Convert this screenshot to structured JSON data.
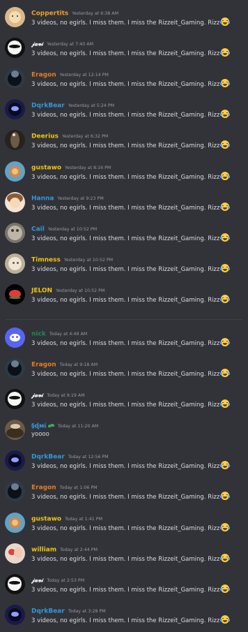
{
  "colors": {
    "background": "#313338",
    "text": "#dbdee1",
    "timestamp": "#949ba4",
    "divider": "#3f4147",
    "name_orange": "#f0a02a",
    "name_red": "#e67e22",
    "name_blue": "#3498db",
    "name_yellow": "#f1c40f",
    "name_green": "#2ecc71",
    "name_dark_green": "#1f8b4c",
    "name_white": "#ffffff"
  },
  "icons": {
    "reaction": "laughing-tears-emoji-icon",
    "badge": "sprout-icon",
    "discord_avatar": "discord-logo-icon"
  },
  "messages": [
    {
      "username": "Coppertits",
      "timestamp": "Yesterday at 6:38 AM",
      "text": "3 videos, no egirls. I miss them. I miss the Rizzeit_Gaming. Rizz",
      "emoji": true,
      "color": "#f0a02a"
    },
    {
      "username": "𝒿𝒶𝓋𝒾",
      "timestamp": "Yesterday at 7:40 AM",
      "text": "3 videos, no egirls. I miss them. I miss the Rizzeit_Gaming. Rizz",
      "emoji": true,
      "color": "#ffffff"
    },
    {
      "username": "Eragon",
      "timestamp": "Yesterday at 12:14 PM",
      "text": "3 videos, no egirls. I miss them. I miss the Rizzeit_Gaming. Rizz",
      "emoji": true,
      "color": "#e67e22"
    },
    {
      "username": "DqrkBear",
      "timestamp": "Yesterday at 5:24 PM",
      "text": "3 videos, no egirls. I miss them. I miss the Rizzeit_Gaming. Rizz",
      "emoji": true,
      "color": "#3498db"
    },
    {
      "username": "Deerius",
      "timestamp": "Yesterday at 6:32 PM",
      "text": "3 videos, no egirls. I miss them. I miss the Rizzeit_Gaming. Rizz",
      "emoji": true,
      "color": "#f1c40f"
    },
    {
      "username": "gustawo",
      "timestamp": "Yesterday at 8:16 PM",
      "text": "3 videos, no egirls. I miss them. I miss the Rizzeit_Gaming. Rizz",
      "emoji": true,
      "color": "#f1c40f"
    },
    {
      "username": "Hanna",
      "timestamp": "Yesterday at 9:23 PM",
      "text": "3 videos, no egirls. I miss them. I miss the Rizzeit_Gaming. Rizz",
      "emoji": true,
      "color": "#3498db"
    },
    {
      "username": "Cail",
      "timestamp": "Yesterday at 10:52 PM",
      "text": "3 videos, no egirls. I miss them. I miss the Rizzeit_Gaming. Rizz",
      "emoji": true,
      "color": "#3498db"
    },
    {
      "username": "Timness",
      "timestamp": "Yesterday at 10:52 PM",
      "text": "3 videos, no egirls. I miss them. I miss the Rizzeit_Gaming. Rizz",
      "emoji": true,
      "color": "#f1c40f"
    },
    {
      "username": "JELON",
      "timestamp": "Yesterday at 10:52 PM",
      "text": "3 videos, no egirls. I miss them. I miss the Rizzeit_Gaming. Rizz",
      "emoji": true,
      "color": "#f1c40f"
    },
    {
      "username": "nick",
      "timestamp": "Today at 4:49 AM",
      "text": "3 videos, no egirls. I miss them. I miss the Rizzeit_Gaming. Rizz",
      "emoji": true,
      "color": "#1f8b4c"
    },
    {
      "username": "Eragon",
      "timestamp": "Today at 9:18 AM",
      "text": "3 videos, no egirls. I miss them. I miss the Rizzeit_Gaming. Rizz",
      "emoji": true,
      "color": "#e67e22"
    },
    {
      "username": "𝒿𝒶𝓋𝒾",
      "timestamp": "Today at 9:19 AM",
      "text": "3 videos, no egirls. I miss them. I miss the Rizzeit_Gaming. Rizz",
      "emoji": true,
      "color": "#ffffff"
    },
    {
      "username": "§ɖмί",
      "timestamp": "Today at 11:20 AM",
      "text": "yoooo",
      "emoji": false,
      "color": "#3498db"
    },
    {
      "username": "DqrkBear",
      "timestamp": "Today at 12:56 PM",
      "text": "3 videos, no egirls. I miss them. I miss the Rizzeit_Gaming. Rizz",
      "emoji": true,
      "color": "#3498db"
    },
    {
      "username": "Eragon",
      "timestamp": "Today at 1:06 PM",
      "text": "3 videos, no egirls. I miss them. I miss the Rizzeit_Gaming. Rizz",
      "emoji": true,
      "color": "#e67e22"
    },
    {
      "username": "gustawo",
      "timestamp": "Today at 1:41 PM",
      "text": "3 videos, no egirls. I miss them. I miss the Rizzeit_Gaming. Rizz",
      "emoji": true,
      "color": "#f1c40f"
    },
    {
      "username": "william",
      "timestamp": "Today at 2:44 PM",
      "text": "3 videos, no egirls. I miss them. I miss the Rizzeit_Gaming. Rizz",
      "emoji": true,
      "color": "#f1c40f"
    },
    {
      "username": "𝒿𝒶𝓋𝒾",
      "timestamp": "Today at 2:53 PM",
      "text": "3 videos, no egirls. I miss them. I miss the Rizzeit_Gaming. Rizz",
      "emoji": true,
      "color": "#ffffff"
    },
    {
      "username": "DqrkBear",
      "timestamp": "Today at 3:28 PM",
      "text": "3 videos, no egirls. I miss them. I miss the Rizzeit_Gaming. Rizz",
      "emoji": true,
      "color": "#3498db"
    }
  ]
}
